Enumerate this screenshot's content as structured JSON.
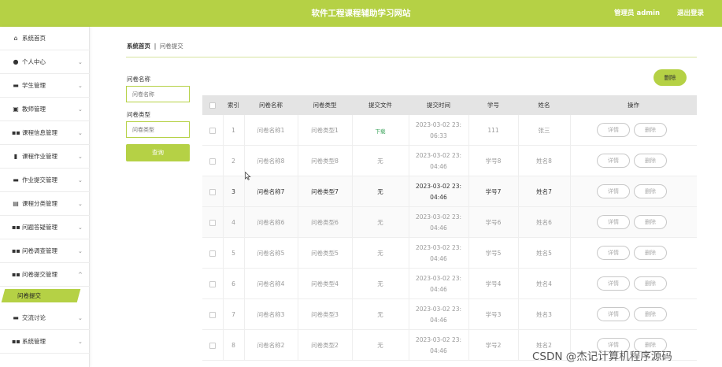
{
  "header": {
    "title": "软件工程课程辅助学习网站",
    "admin": "管理员 admin",
    "logout": "退出登录",
    "accent": "#b5d145"
  },
  "sidebar": {
    "items": [
      {
        "label": "系统首页",
        "icon": "home-icon",
        "glyph": "⌂"
      },
      {
        "label": "个人中心",
        "icon": "user-icon",
        "glyph": "●"
      },
      {
        "label": "学生管理",
        "icon": "monitor-icon",
        "glyph": "▬"
      },
      {
        "label": "教师管理",
        "icon": "clipboard-icon",
        "glyph": "▣"
      },
      {
        "label": "课程信息管理",
        "icon": "grid-icon",
        "glyph": "▪▪"
      },
      {
        "label": "课程作业管理",
        "icon": "bar-chart-icon",
        "glyph": "▮"
      },
      {
        "label": "作业提交管理",
        "icon": "briefcase-icon",
        "glyph": "▬"
      },
      {
        "label": "课程分类管理",
        "icon": "document-icon",
        "glyph": "▤"
      },
      {
        "label": "问题答疑管理",
        "icon": "grid-icon",
        "glyph": "▪▪"
      },
      {
        "label": "问卷调查管理",
        "icon": "grid-icon",
        "glyph": "▪▪"
      },
      {
        "label": "问卷提交管理",
        "icon": "grid-icon",
        "glyph": "▪▪"
      },
      {
        "label": "交流讨论",
        "icon": "monitor-icon",
        "glyph": "▬"
      },
      {
        "label": "系统管理",
        "icon": "grid-icon",
        "glyph": "▪▪"
      }
    ],
    "active_sub": "问卷提交"
  },
  "breadcrumb": {
    "home": "系统首页",
    "sep": "‖",
    "current": "问卷提交"
  },
  "search": {
    "name_label": "问卷名称",
    "name_placeholder": "问卷名称",
    "type_label": "问卷类型",
    "type_placeholder": "问卷类型",
    "query_label": "查询"
  },
  "actions": {
    "delete_label": "删除"
  },
  "table": {
    "headers": [
      "",
      "索引",
      "问卷名称",
      "问卷类型",
      "提交文件",
      "提交时间",
      "学号",
      "姓名",
      "操作"
    ],
    "rows": [
      {
        "idx": "1",
        "name": "问卷名称1",
        "type": "问卷类型1",
        "file": "下载",
        "time1": "2023-03-02 23:",
        "time2": "06:33",
        "sid": "111",
        "sname": "张三"
      },
      {
        "idx": "2",
        "name": "问卷名称8",
        "type": "问卷类型8",
        "file": "无",
        "time1": "2023-03-02 23:",
        "time2": "04:46",
        "sid": "学号8",
        "sname": "姓名8"
      },
      {
        "idx": "3",
        "name": "问卷名称7",
        "type": "问卷类型7",
        "file": "无",
        "time1": "2023-03-02 23:",
        "time2": "04:46",
        "sid": "学号7",
        "sname": "姓名7"
      },
      {
        "idx": "4",
        "name": "问卷名称6",
        "type": "问卷类型6",
        "file": "无",
        "time1": "2023-03-02 23:",
        "time2": "04:46",
        "sid": "学号6",
        "sname": "姓名6"
      },
      {
        "idx": "5",
        "name": "问卷名称5",
        "type": "问卷类型5",
        "file": "无",
        "time1": "2023-03-02 23:",
        "time2": "04:46",
        "sid": "学号5",
        "sname": "姓名5"
      },
      {
        "idx": "6",
        "name": "问卷名称4",
        "type": "问卷类型4",
        "file": "无",
        "time1": "2023-03-02 23:",
        "time2": "04:46",
        "sid": "学号4",
        "sname": "姓名4"
      },
      {
        "idx": "7",
        "name": "问卷名称3",
        "type": "问卷类型3",
        "file": "无",
        "time1": "2023-03-02 23:",
        "time2": "04:46",
        "sid": "学号3",
        "sname": "姓名3"
      },
      {
        "idx": "8",
        "name": "问卷名称2",
        "type": "问卷类型2",
        "file": "无",
        "time1": "2023-03-02 23:",
        "time2": "04:46",
        "sid": "学号2",
        "sname": "姓名2"
      }
    ],
    "detail_label": "详情",
    "row_delete_label": "删除"
  },
  "watermark": "CSDN @杰记计算机程序源码"
}
